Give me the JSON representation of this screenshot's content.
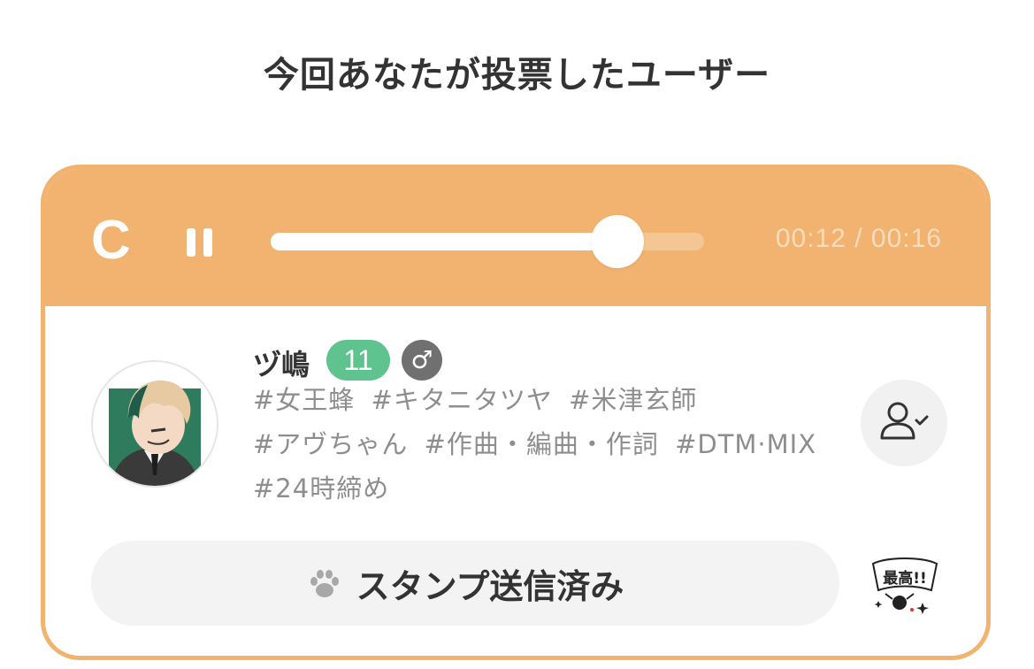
{
  "page": {
    "title": "今回あなたが投票したユーザー"
  },
  "player": {
    "logo_letter": "C",
    "progress": 0.8,
    "time_readout": "00:12 / 00:16",
    "colors": {
      "bar": "#f1b36f",
      "track": "rgba(255,255,255,0.25)",
      "fill": "#ffffff"
    }
  },
  "user": {
    "name": "ヅ嶋",
    "level": "11",
    "gender_symbol": "♂",
    "tags": [
      "#女王蜂",
      "#キタニタツヤ",
      "#米津玄師",
      "#アヴちゃん",
      "#作曲・編曲・作詞",
      "#DTM·MIX",
      "#24時締め"
    ],
    "colors": {
      "level_badge": "#5fc38f",
      "gender_badge": "#707070"
    }
  },
  "actions": {
    "stamp_label": "スタンプ送信済み",
    "stamp_icon": "paw-icon",
    "follow_icon": "user-check-icon",
    "sticker_text": "最高!!"
  }
}
